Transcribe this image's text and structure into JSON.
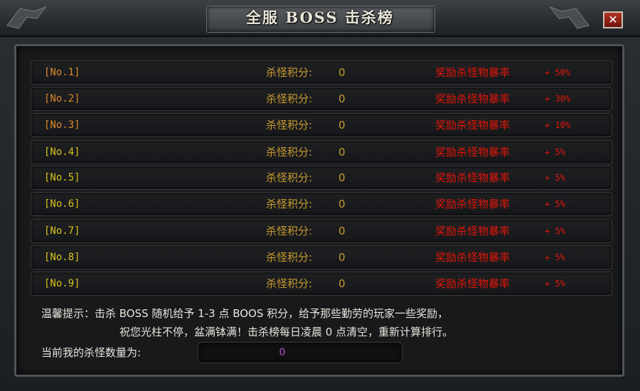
{
  "window": {
    "title": "全服 BOSS 击杀榜",
    "close_label": "✕"
  },
  "ranks": [
    {
      "rank": "[No.1]",
      "score_label": "杀怪积分:",
      "score": "0",
      "reward_label": "奖励杀怪物暴率",
      "reward_value": "+ 50%",
      "rank_color": "#d98a2a"
    },
    {
      "rank": "[No.2]",
      "score_label": "杀怪积分:",
      "score": "0",
      "reward_label": "奖励杀怪物暴率",
      "reward_value": "+ 30%",
      "rank_color": "#d98a2a"
    },
    {
      "rank": "[No.3]",
      "score_label": "杀怪积分:",
      "score": "0",
      "reward_label": "奖励杀怪物暴率",
      "reward_value": "+ 10%",
      "rank_color": "#d98a2a"
    },
    {
      "rank": "[No.4]",
      "score_label": "杀怪积分:",
      "score": "0",
      "reward_label": "奖励杀怪物暴率",
      "reward_value": "+ 5%",
      "rank_color": "#d6c21f"
    },
    {
      "rank": "[No.5]",
      "score_label": "杀怪积分:",
      "score": "0",
      "reward_label": "奖励杀怪物暴率",
      "reward_value": "+ 5%",
      "rank_color": "#d6c21f"
    },
    {
      "rank": "[No.6]",
      "score_label": "杀怪积分:",
      "score": "0",
      "reward_label": "奖励杀怪物暴率",
      "reward_value": "+ 5%",
      "rank_color": "#d6c21f"
    },
    {
      "rank": "[No.7]",
      "score_label": "杀怪积分:",
      "score": "0",
      "reward_label": "奖励杀怪物暴率",
      "reward_value": "+ 5%",
      "rank_color": "#d6c21f"
    },
    {
      "rank": "[No.8]",
      "score_label": "杀怪积分:",
      "score": "0",
      "reward_label": "奖励杀怪物暴率",
      "reward_value": "+ 5%",
      "rank_color": "#d6c21f"
    },
    {
      "rank": "[No.9]",
      "score_label": "杀怪积分:",
      "score": "0",
      "reward_label": "奖励杀怪物暴率",
      "reward_value": "+ 5%",
      "rank_color": "#d6c21f"
    }
  ],
  "tips": {
    "line1": "温馨提示：击杀 BOSS 随机给予 1-3 点 BOOS 积分，给予那些勤劳的玩家一些奖励，",
    "line2": "祝您光柱不停，盆满钵满！击杀榜每日凌晨 0 点清空，重新计算排行。"
  },
  "current": {
    "label": "当前我的杀怪数量为:",
    "value": "0"
  },
  "colors": {
    "score": "#c99b30",
    "reward": "#e0160a",
    "current_value": "#b64fd0"
  }
}
